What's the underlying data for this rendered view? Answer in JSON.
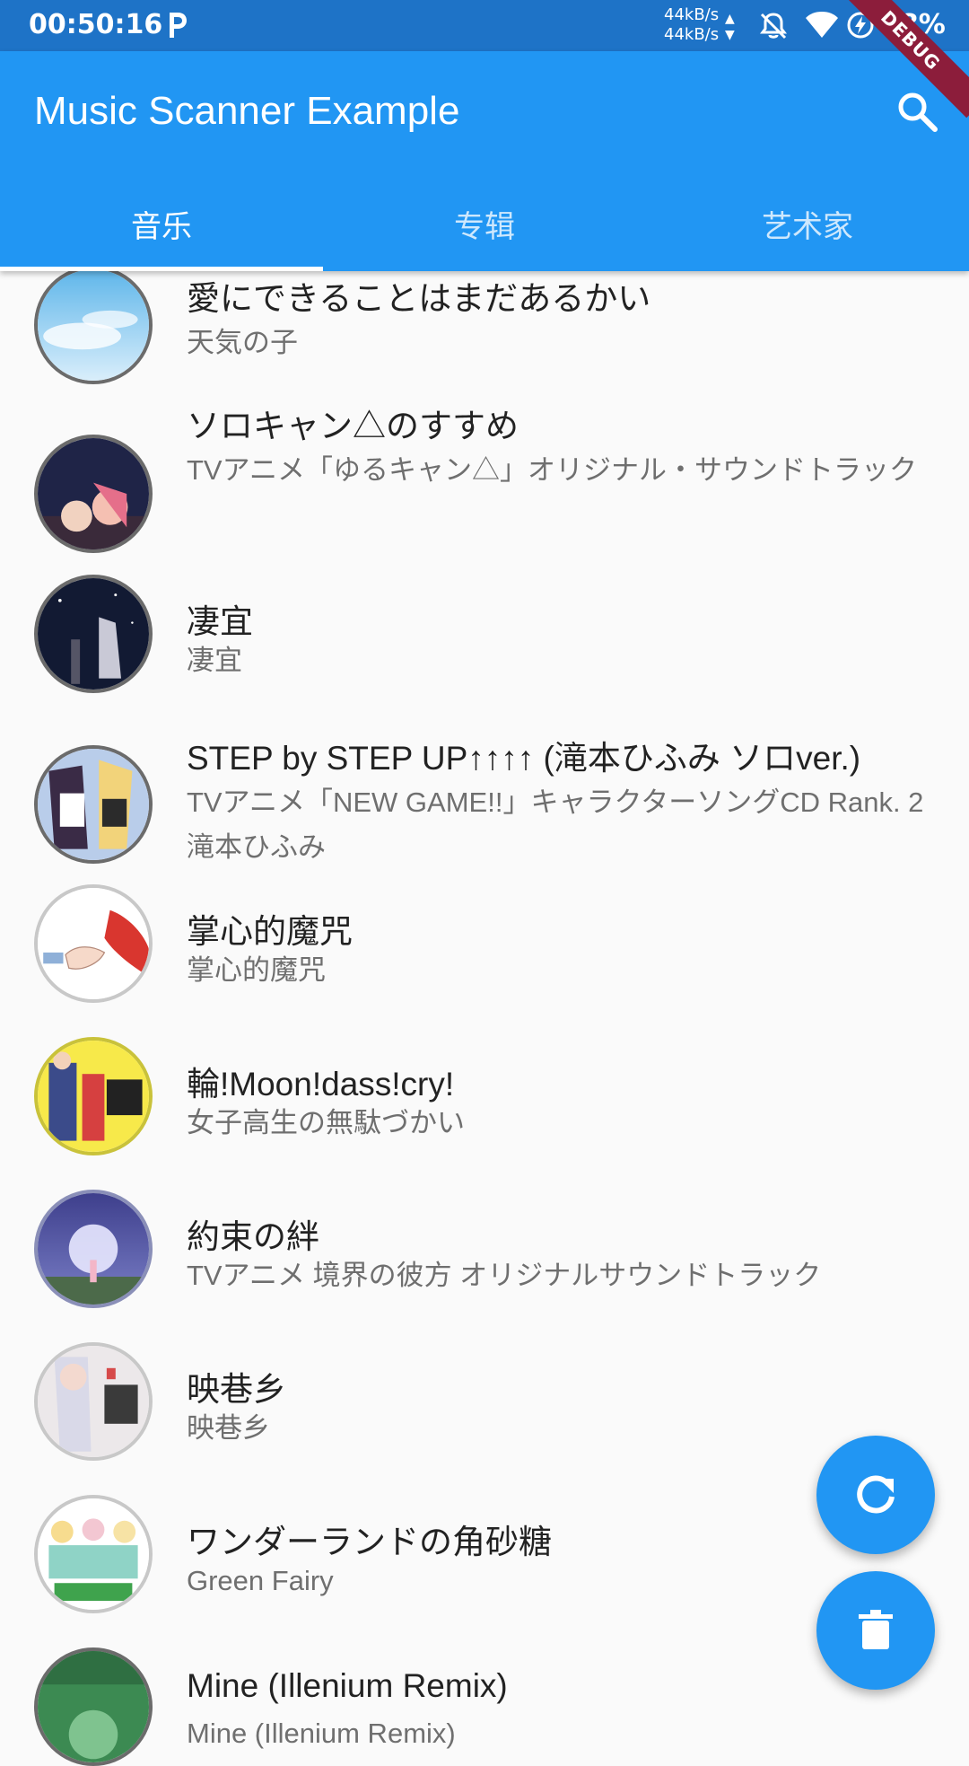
{
  "status_bar": {
    "time": "00:50:16",
    "net_up": "44kB/s",
    "net_down": "44kB/s",
    "battery": "98%",
    "debug_label": "DEBUG"
  },
  "app_bar": {
    "title": "Music Scanner Example"
  },
  "tabs": [
    {
      "label": "音乐",
      "active": true
    },
    {
      "label": "专辑",
      "active": false
    },
    {
      "label": "艺术家",
      "active": false
    }
  ],
  "songs": [
    {
      "title": "愛にできることはまだあるかい",
      "subtitle": "天気の子"
    },
    {
      "title": "ソロキャン△のすすめ",
      "subtitle": "TVアニメ「ゆるキャン△」オリジナル・サウンドトラック"
    },
    {
      "title": "凄宜",
      "subtitle": "凄宜"
    },
    {
      "title": "STEP by STEP UP↑↑↑↑ (滝本ひふみ ソロver.)",
      "subtitle": "TVアニメ「NEW GAME!!」キャラクターソングCD Rank. 2 滝本ひふみ"
    },
    {
      "title": "掌心的魔咒",
      "subtitle": "掌心的魔咒"
    },
    {
      "title": "輪!Moon!dass!cry!",
      "subtitle": "女子高生の無駄づかい"
    },
    {
      "title": "約束の絆",
      "subtitle": "TVアニメ 境界の彼方 オリジナルサウンドトラック"
    },
    {
      "title": "映巷乡",
      "subtitle": "映巷乡"
    },
    {
      "title": "ワンダーランドの角砂糖",
      "subtitle": "Green Fairy"
    },
    {
      "title": "Mine (Illenium Remix)",
      "subtitle": "Mine (Illenium Remix)"
    }
  ],
  "colors": {
    "primary": "#2196f3",
    "status_bar": "#1e73c7",
    "debug_ribbon": "#8c1d3b"
  }
}
